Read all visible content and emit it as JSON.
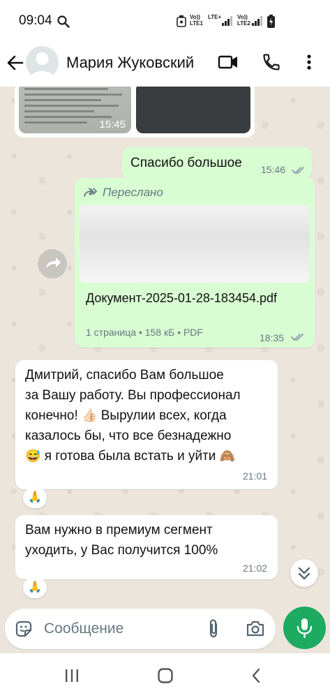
{
  "status_bar": {
    "time": "09:04",
    "sim1": "LTE1",
    "sim2": "LTE2",
    "volte": "Vo))",
    "lte_plus": "LTE+"
  },
  "header": {
    "contact_name": "Мария Жуковский"
  },
  "messages": {
    "image_time": "15:45",
    "thanks_text": "Спасибо большое",
    "thanks_time": "15:46",
    "forwarded_label": "Переслано",
    "doc_name": "Документ-2025-01-28-183454.pdf",
    "doc_meta": "1 страница • 158 кБ • PDF",
    "doc_time": "18:35",
    "msg1_line1": "Дмитрий, спасибо Вам большое",
    "msg1_line2": "за Вашу работу. Вы профессионал",
    "msg1_line3a": "конечно!",
    "msg1_emoji_thumb": "👍🏻",
    "msg1_line3b": "Вырулии всех, когда",
    "msg1_line4": "казалось бы, что все безнадежно",
    "msg1_emoji_sweat": "😅",
    "msg1_line5": "я готова была встать и уйти",
    "msg1_emoji_monkey": "🙈",
    "msg1_time": "21:01",
    "msg1_reaction": "🙏",
    "msg2_line1": "Вам нужно в премиум сегмент",
    "msg2_line2": "уходить, у Вас получится 100%",
    "msg2_time": "21:02",
    "msg2_reaction": "🙏"
  },
  "composer": {
    "placeholder": "Сообщение"
  },
  "colors": {
    "outgoing": "#d9fdd3",
    "incoming": "#ffffff",
    "accent": "#1daa61",
    "read_ticks": "#8696a0"
  }
}
